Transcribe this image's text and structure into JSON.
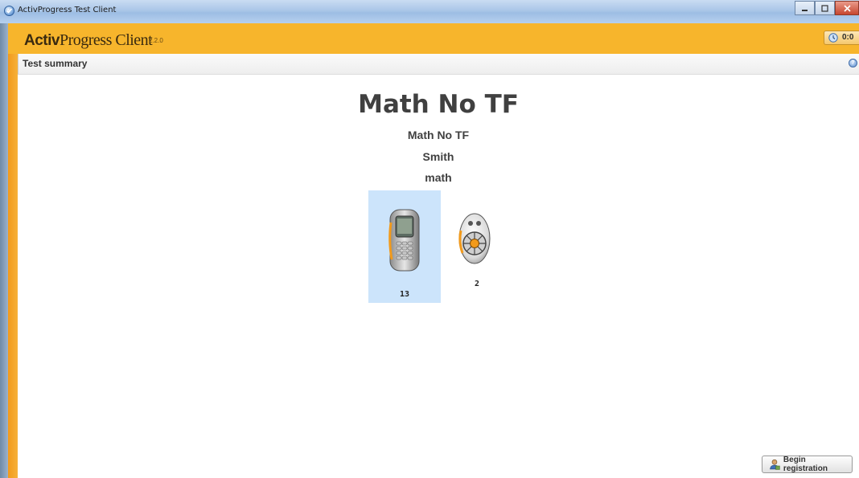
{
  "window": {
    "title": "ActivProgress Test Client",
    "icon": "checkmark-circle-icon",
    "controls": [
      "minimize-icon",
      "maximize-icon",
      "close-icon"
    ]
  },
  "header": {
    "brand_bold": "Activ",
    "brand_rest": "Progress Client",
    "version": "2.2.0",
    "timer": "0:0",
    "timer_icon": "clock-icon",
    "background": "#f7b52c"
  },
  "panel": {
    "title": "Test summary",
    "help_icon": "help-icon"
  },
  "test": {
    "name": "Math No TF",
    "subtitle": "Math No TF",
    "teacher": "Smith",
    "subject": "math"
  },
  "devices": [
    {
      "type": "phone-voting-device-icon",
      "count": "13",
      "selected": true
    },
    {
      "type": "keypad-voting-device-icon",
      "count": "2",
      "selected": false
    }
  ],
  "actions": {
    "begin_registration": "Begin registration",
    "begin_icon": "user-registration-icon"
  },
  "colors": {
    "accent": "#f7b52c",
    "selection": "#cce4fb",
    "text": "#404040"
  }
}
